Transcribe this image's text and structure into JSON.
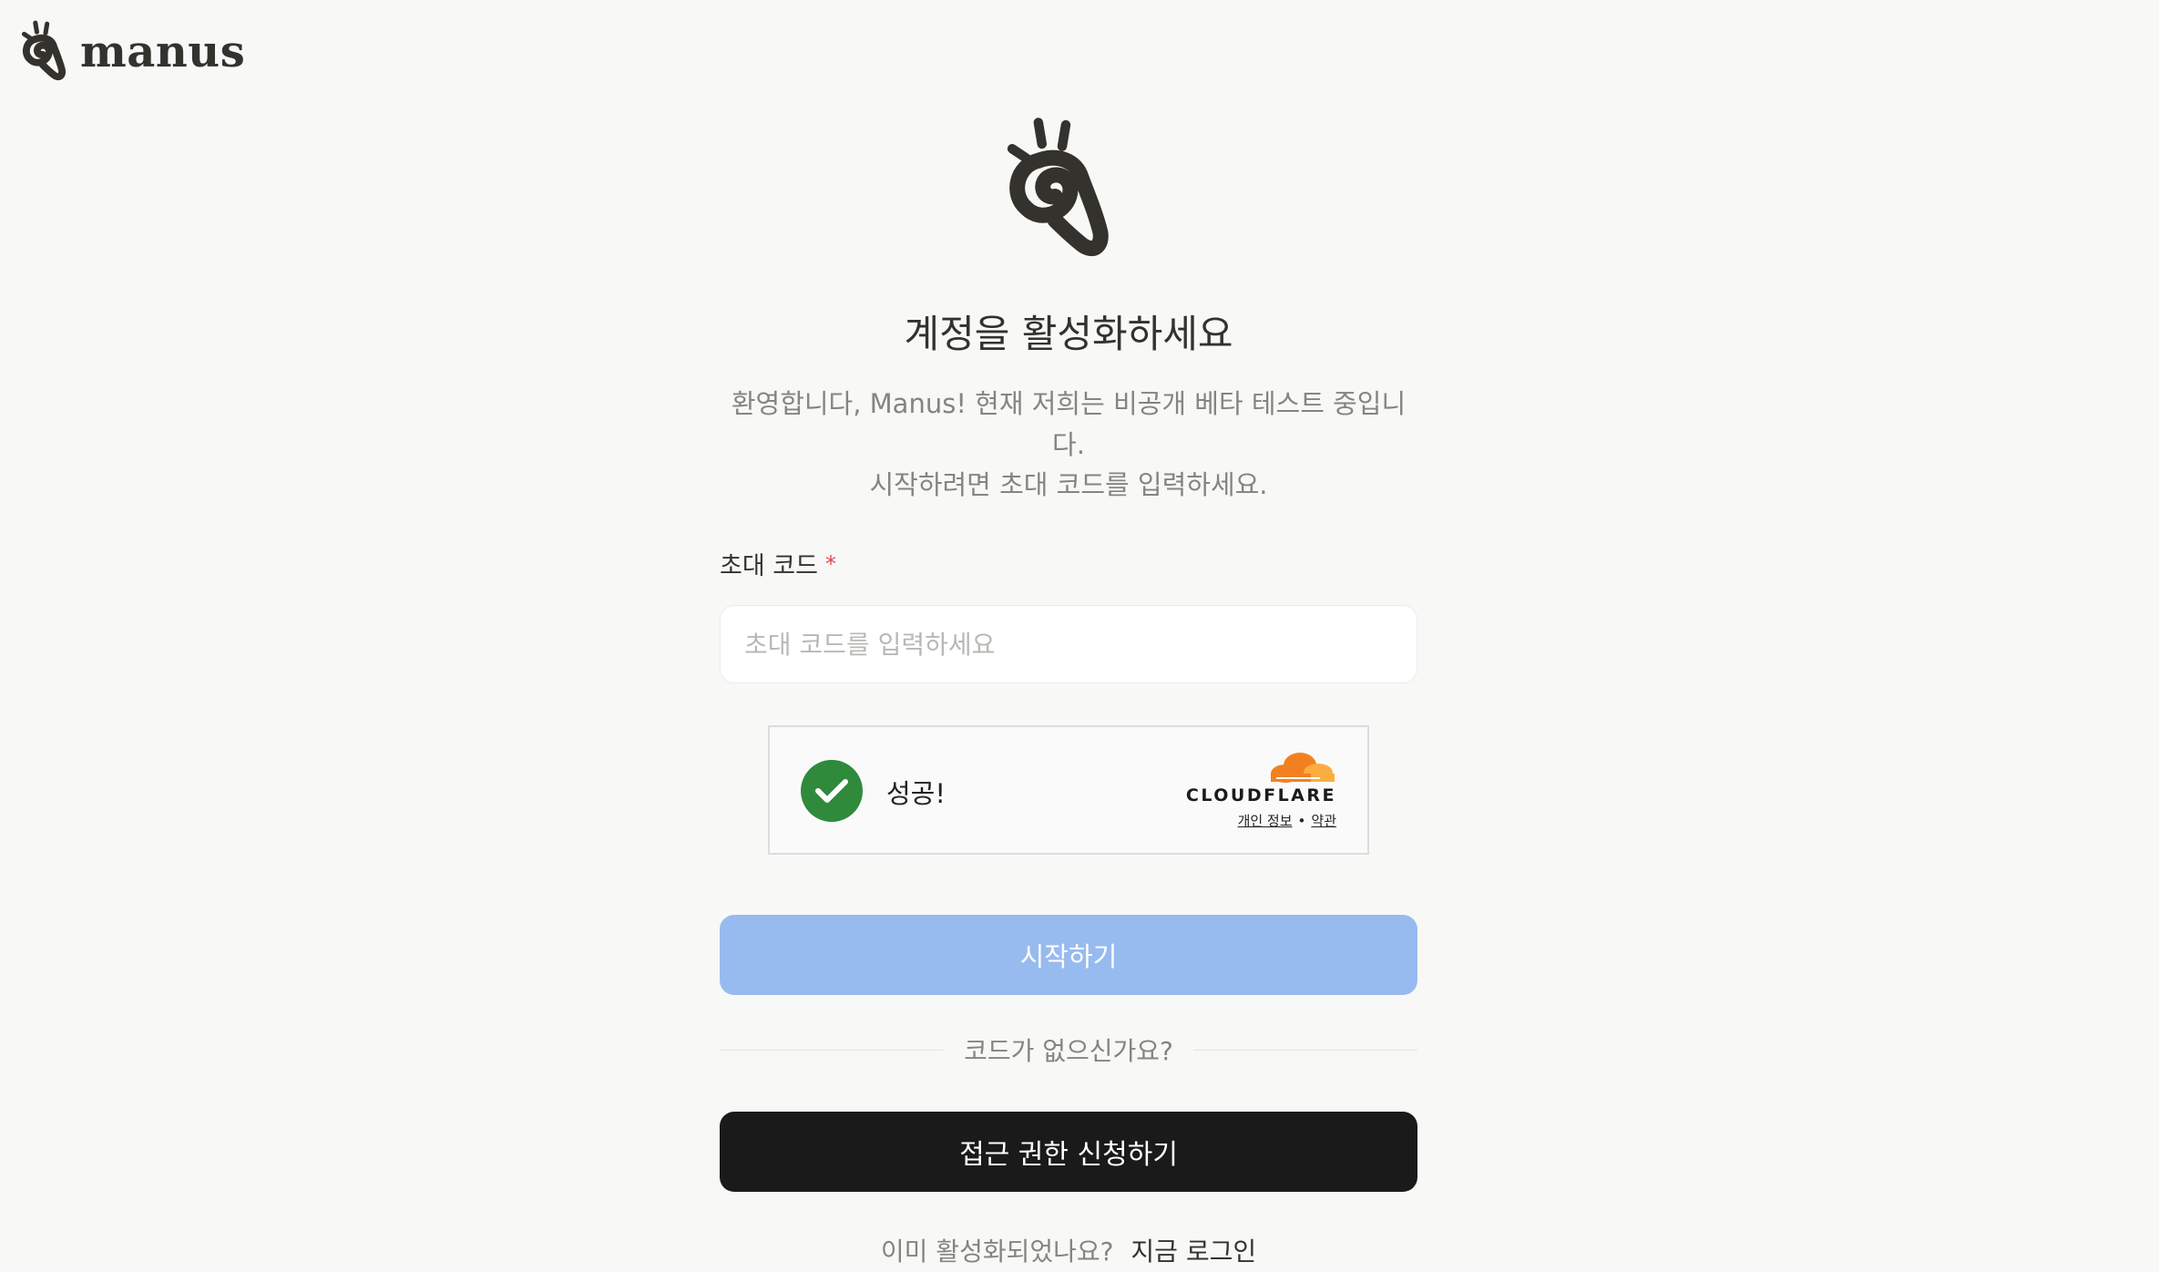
{
  "header": {
    "logo_icon": "manus-hand-icon",
    "brand_name": "manus"
  },
  "hero": {
    "logo_icon": "manus-hand-icon"
  },
  "activation": {
    "title": "계정을 활성화하세요",
    "description_line1": "환영합니다, Manus! 현재 저희는 비공개 베타 테스트 중입니다.",
    "description_line2": "시작하려면 초대 코드를 입력하세요.",
    "invite_label": "초대 코드",
    "required_mark": "*",
    "invite_value": "",
    "invite_placeholder": "초대 코드를 입력하세요"
  },
  "captcha": {
    "status_icon": "check-circle-icon",
    "status_text": "성공!",
    "provider": "CLOUDFLARE",
    "provider_icon": "cloudflare-cloud-icon",
    "privacy_link": "개인 정보",
    "separator": "•",
    "terms_link": "약관",
    "status_color": "#2f8a3c"
  },
  "actions": {
    "start_label": "시작하기",
    "no_code_text": "코드가 없으신가요?",
    "request_label": "접근 권한 신청하기",
    "already_text": "이미 활성화되었나요?",
    "login_link": "지금 로그인"
  },
  "colors": {
    "background": "#f8f8f7",
    "primary_disabled": "#98bbef",
    "dark_button": "#1a1a1a",
    "required": "#e5484d"
  }
}
